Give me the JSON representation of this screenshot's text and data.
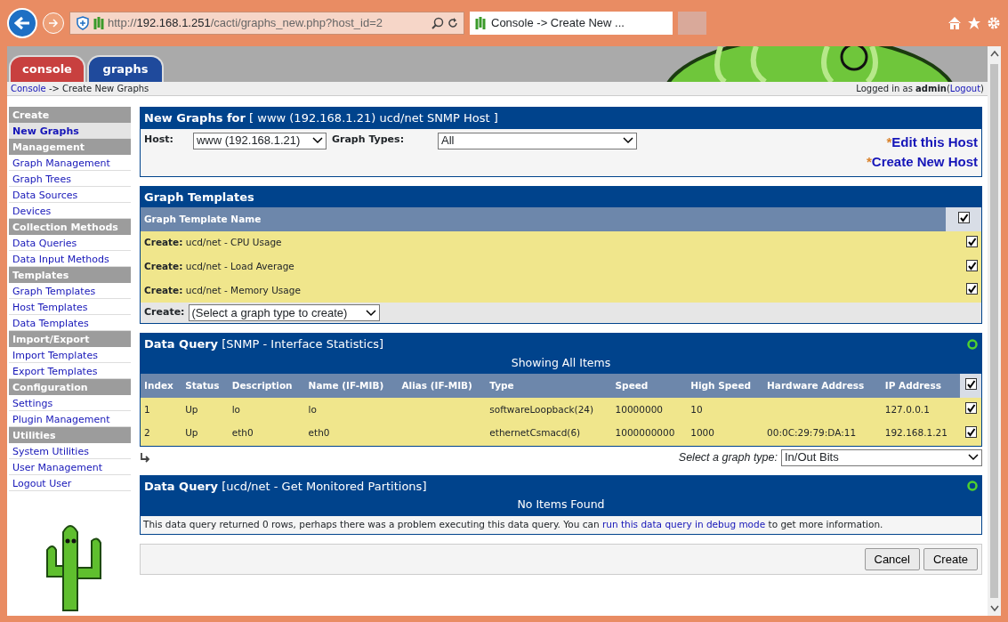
{
  "browser": {
    "address": {
      "prefix": "http://",
      "host": "192.168.1.251",
      "path": "/cacti/graphs_new.php?host_id=2"
    },
    "tab": {
      "title": "Console -> Create New ..."
    }
  },
  "header": {
    "tabs": [
      {
        "label": "console",
        "selected": true
      },
      {
        "label": "graphs",
        "selected": false
      }
    ]
  },
  "breadcrumb": {
    "link": "Console",
    "rest": " -> Create New Graphs",
    "login_prefix": "Logged in as ",
    "user": "admin",
    "logout_open": "(",
    "logout": "Logout",
    "logout_close": ")"
  },
  "sidebar": {
    "items": [
      {
        "kind": "header",
        "label": "Create"
      },
      {
        "kind": "link",
        "label": "New Graphs",
        "selected": true
      },
      {
        "kind": "header",
        "label": "Management"
      },
      {
        "kind": "link",
        "label": "Graph Management",
        "selected": false
      },
      {
        "kind": "link",
        "label": "Graph Trees",
        "selected": false
      },
      {
        "kind": "link",
        "label": "Data Sources",
        "selected": false
      },
      {
        "kind": "link",
        "label": "Devices",
        "selected": false
      },
      {
        "kind": "header",
        "label": "Collection Methods"
      },
      {
        "kind": "link",
        "label": "Data Queries",
        "selected": false
      },
      {
        "kind": "link",
        "label": "Data Input Methods",
        "selected": false
      },
      {
        "kind": "header",
        "label": "Templates"
      },
      {
        "kind": "link",
        "label": "Graph Templates",
        "selected": false
      },
      {
        "kind": "link",
        "label": "Host Templates",
        "selected": false
      },
      {
        "kind": "link",
        "label": "Data Templates",
        "selected": false
      },
      {
        "kind": "header",
        "label": "Import/Export"
      },
      {
        "kind": "link",
        "label": "Import Templates",
        "selected": false
      },
      {
        "kind": "link",
        "label": "Export Templates",
        "selected": false
      },
      {
        "kind": "header",
        "label": "Configuration"
      },
      {
        "kind": "link",
        "label": "Settings",
        "selected": false
      },
      {
        "kind": "link",
        "label": "Plugin Management",
        "selected": false
      },
      {
        "kind": "header",
        "label": "Utilities"
      },
      {
        "kind": "link",
        "label": "System Utilities",
        "selected": false
      },
      {
        "kind": "link",
        "label": "User Management",
        "selected": false
      },
      {
        "kind": "link",
        "label": "Logout User",
        "selected": false
      }
    ]
  },
  "host_panel": {
    "title": "New Graphs for",
    "subtitle": "[ www (192.168.1.21) ucd/net SNMP Host ]",
    "host_label": "Host:",
    "host_value": "www (192.168.1.21)",
    "types_label": "Graph Types:",
    "types_value": "All",
    "links": [
      {
        "marker": "*",
        "label": "Edit this Host"
      },
      {
        "marker": "*",
        "label": "Create New Host"
      }
    ]
  },
  "graph_templates": {
    "title": "Graph Templates",
    "column": "Graph Template Name",
    "all_checked": true,
    "rows": [
      {
        "prefix": "Create:",
        "name": "ucd/net - CPU Usage",
        "checked": true
      },
      {
        "prefix": "Create:",
        "name": "ucd/net - Load Average",
        "checked": true
      },
      {
        "prefix": "Create:",
        "name": "ucd/net - Memory Usage",
        "checked": true
      }
    ],
    "create_label": "Create:",
    "create_value": "(Select a graph type to create)"
  },
  "data_queries": [
    {
      "title": "Data Query",
      "name": "[SNMP - Interface Statistics]",
      "status": "Showing All Items",
      "columns": [
        "Index",
        "Status",
        "Description",
        "Name (IF-MIB)",
        "Alias (IF-MIB)",
        "Type",
        "Speed",
        "High Speed",
        "Hardware Address",
        "IP Address"
      ],
      "all_checked": true,
      "rows": [
        {
          "cells": [
            "1",
            "Up",
            "lo",
            "lo",
            "",
            "softwareLoopback(24)",
            "10000000",
            "10",
            "",
            "127.0.0.1"
          ],
          "checked": true
        },
        {
          "cells": [
            "2",
            "Up",
            "eth0",
            "eth0",
            "",
            "ethernetCsmacd(6)",
            "1000000000",
            "1000",
            "00:0C:29:79:DA:11",
            "192.168.1.21"
          ],
          "checked": true
        }
      ],
      "select_label": "Select a graph type:",
      "select_value": "In/Out Bits"
    },
    {
      "title": "Data Query",
      "name": "[ucd/net - Get Monitored Partitions]",
      "status": "No Items Found",
      "message": {
        "before": "This data query returned 0 rows, perhaps there was a problem executing this data query. You can ",
        "link": "run this data query in debug mode",
        "after": " to get more information."
      }
    }
  ],
  "buttons": [
    "Cancel",
    "Create"
  ]
}
